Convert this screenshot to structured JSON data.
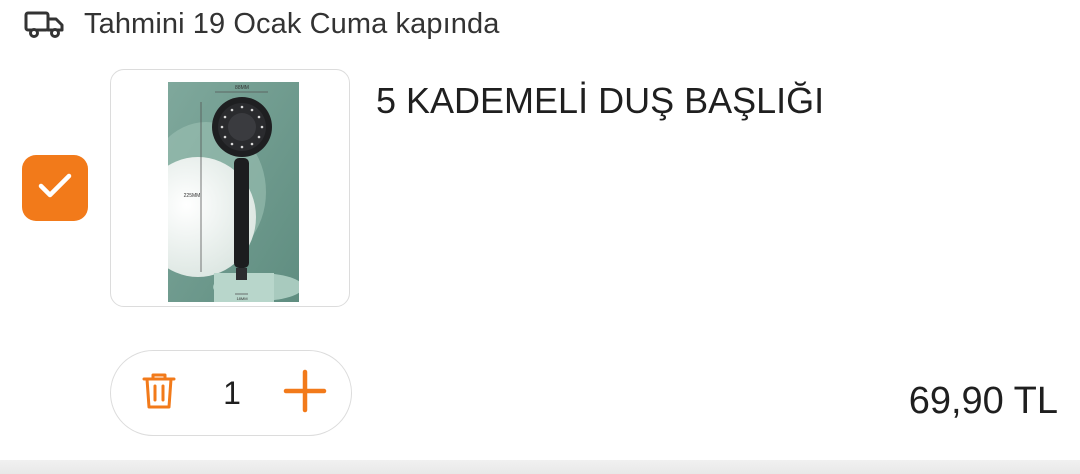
{
  "delivery": {
    "icon": "truck-icon",
    "text": "Tahmini 19 Ocak Cuma kapında"
  },
  "item": {
    "selected": true,
    "checkbox_icon": "checkmark-icon",
    "title": "5 KADEMELİ DUŞ BAŞLIĞI",
    "image": {
      "icon": "shower-head-product-image",
      "dim_top": "88MM",
      "dim_side": "225MM",
      "dim_bottom": "18MM"
    },
    "quantity": "1",
    "price": "69,90 TL"
  },
  "colors": {
    "accent": "#f27a1a",
    "text": "#1f1f1f",
    "border": "#dcdcdc"
  }
}
